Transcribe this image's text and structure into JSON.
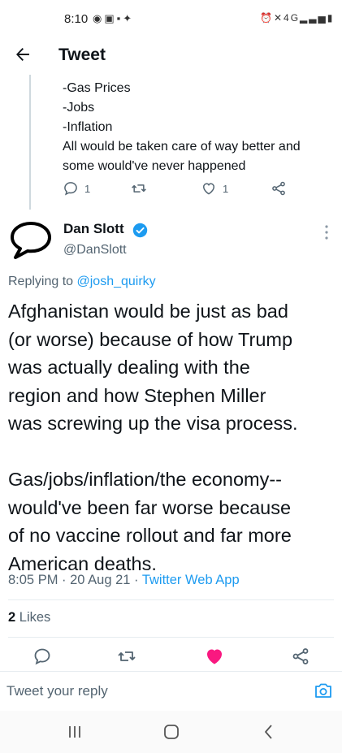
{
  "status_bar": {
    "time": "8:10",
    "left_icons": [
      "sync-icon",
      "teams-icon",
      "gallery-icon",
      "twitter-icon"
    ],
    "right_icons": [
      "alarm-icon",
      "mute-icon",
      "4g-lte-icon",
      "signal-icon",
      "battery-icon"
    ],
    "network_label": "4G"
  },
  "app_bar": {
    "title": "Tweet"
  },
  "parent_tweet": {
    "lines": [
      "-Gas Prices",
      "-Jobs",
      "-Inflation",
      "All would be taken care of way better and",
      "some would've never happened"
    ],
    "reply_count": "1",
    "retweet_count": "",
    "like_count": "1"
  },
  "tweet": {
    "author_name": "Dan Slott",
    "author_handle": "@DanSlott",
    "replying_prefix": "Replying to ",
    "replying_to": "@josh_quirky",
    "paragraph1": [
      "Afghanistan would be just as bad",
      "(or worse) because of how Trump",
      "was actually dealing with the",
      "region and how Stephen Miller",
      "was screwing up the visa process."
    ],
    "paragraph2": [
      "Gas/jobs/inflation/the economy--",
      "would've been far worse because",
      "of no vaccine rollout and far more",
      "American deaths."
    ],
    "time": "8:05 PM",
    "date": "20 Aug 21",
    "separator": " · ",
    "source": "Twitter Web App",
    "likes_count": "2",
    "likes_label": " Likes",
    "liked": true
  },
  "reply_bar": {
    "placeholder": "Tweet your reply"
  },
  "colors": {
    "accent": "#1d9bf0",
    "like": "#f91880",
    "muted": "#536471",
    "text": "#0f1419"
  }
}
